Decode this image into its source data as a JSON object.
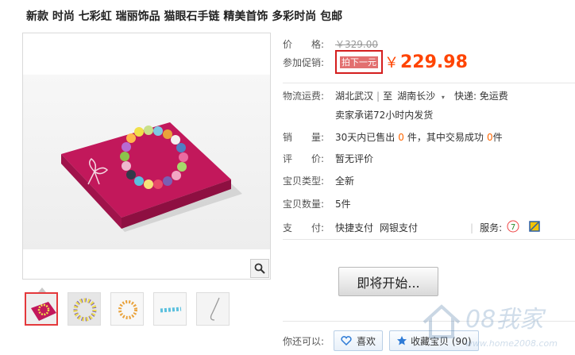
{
  "product": {
    "title": "新款 时尚 七彩虹 瑞丽饰品 猫眼石手链 精美首饰 多彩时尚 包邮"
  },
  "price": {
    "label": "价　　格:",
    "original": "￥329.00"
  },
  "promotion": {
    "label": "参加促销:",
    "tag": "拍下一元",
    "currency": "￥",
    "price": "229.98"
  },
  "shipping": {
    "label": "物流运费:",
    "from": "湖北武汉",
    "to_word": "至",
    "to": "湖南长沙",
    "express": "快递: 免运费",
    "promise": "卖家承诺72小时内发货"
  },
  "sales": {
    "label": "销　　量:",
    "prefix": "30天内已售出",
    "sold": "0",
    "unit1": "件，其中交易成功",
    "success": "0",
    "unit2": "件"
  },
  "rating": {
    "label": "评　　价:",
    "value": "暂无评价"
  },
  "item_type": {
    "label": "宝贝类型:",
    "value": "全新"
  },
  "quantity": {
    "label": "宝贝数量:",
    "value": "5件"
  },
  "payment": {
    "label": "支　　付:",
    "method1": "快捷支付",
    "method2": "网银支付",
    "service_label": "服务:"
  },
  "actions": {
    "start": "即将开始...",
    "you_can": "你还可以:",
    "like": "喜欢",
    "favorite": "收藏宝贝 (90)"
  },
  "watermark": {
    "brand": "08我家",
    "url": "www.home2008.com"
  },
  "colors": {
    "price_orange": "#ff4400",
    "promo_red": "#d41e1e",
    "box_pink": "#c2185b"
  },
  "icons": [
    "zoom-icon",
    "heart-icon",
    "star-icon",
    "shield-icon",
    "alipay-icon",
    "chevron-down-icon"
  ]
}
